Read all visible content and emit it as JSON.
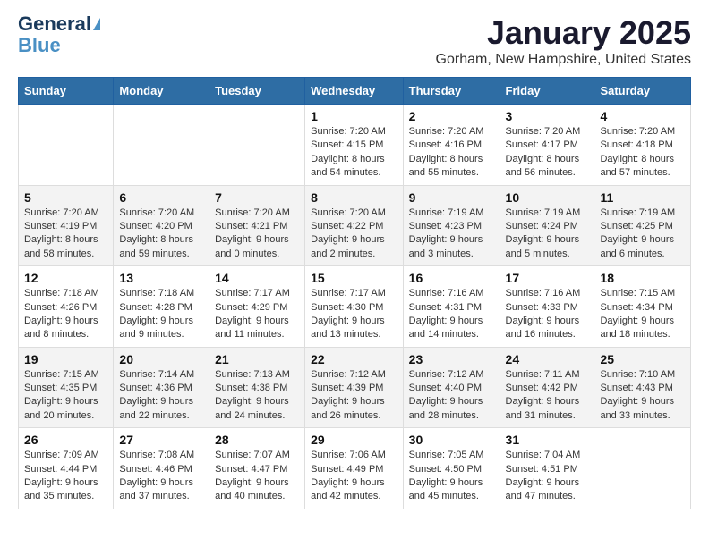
{
  "header": {
    "logo_general": "General",
    "logo_blue": "Blue",
    "month_title": "January 2025",
    "location": "Gorham, New Hampshire, United States"
  },
  "weekdays": [
    "Sunday",
    "Monday",
    "Tuesday",
    "Wednesday",
    "Thursday",
    "Friday",
    "Saturday"
  ],
  "weeks": [
    [
      {
        "day": "",
        "sunrise": "",
        "sunset": "",
        "daylight": ""
      },
      {
        "day": "",
        "sunrise": "",
        "sunset": "",
        "daylight": ""
      },
      {
        "day": "",
        "sunrise": "",
        "sunset": "",
        "daylight": ""
      },
      {
        "day": "1",
        "sunrise": "Sunrise: 7:20 AM",
        "sunset": "Sunset: 4:15 PM",
        "daylight": "Daylight: 8 hours and 54 minutes."
      },
      {
        "day": "2",
        "sunrise": "Sunrise: 7:20 AM",
        "sunset": "Sunset: 4:16 PM",
        "daylight": "Daylight: 8 hours and 55 minutes."
      },
      {
        "day": "3",
        "sunrise": "Sunrise: 7:20 AM",
        "sunset": "Sunset: 4:17 PM",
        "daylight": "Daylight: 8 hours and 56 minutes."
      },
      {
        "day": "4",
        "sunrise": "Sunrise: 7:20 AM",
        "sunset": "Sunset: 4:18 PM",
        "daylight": "Daylight: 8 hours and 57 minutes."
      }
    ],
    [
      {
        "day": "5",
        "sunrise": "Sunrise: 7:20 AM",
        "sunset": "Sunset: 4:19 PM",
        "daylight": "Daylight: 8 hours and 58 minutes."
      },
      {
        "day": "6",
        "sunrise": "Sunrise: 7:20 AM",
        "sunset": "Sunset: 4:20 PM",
        "daylight": "Daylight: 8 hours and 59 minutes."
      },
      {
        "day": "7",
        "sunrise": "Sunrise: 7:20 AM",
        "sunset": "Sunset: 4:21 PM",
        "daylight": "Daylight: 9 hours and 0 minutes."
      },
      {
        "day": "8",
        "sunrise": "Sunrise: 7:20 AM",
        "sunset": "Sunset: 4:22 PM",
        "daylight": "Daylight: 9 hours and 2 minutes."
      },
      {
        "day": "9",
        "sunrise": "Sunrise: 7:19 AM",
        "sunset": "Sunset: 4:23 PM",
        "daylight": "Daylight: 9 hours and 3 minutes."
      },
      {
        "day": "10",
        "sunrise": "Sunrise: 7:19 AM",
        "sunset": "Sunset: 4:24 PM",
        "daylight": "Daylight: 9 hours and 5 minutes."
      },
      {
        "day": "11",
        "sunrise": "Sunrise: 7:19 AM",
        "sunset": "Sunset: 4:25 PM",
        "daylight": "Daylight: 9 hours and 6 minutes."
      }
    ],
    [
      {
        "day": "12",
        "sunrise": "Sunrise: 7:18 AM",
        "sunset": "Sunset: 4:26 PM",
        "daylight": "Daylight: 9 hours and 8 minutes."
      },
      {
        "day": "13",
        "sunrise": "Sunrise: 7:18 AM",
        "sunset": "Sunset: 4:28 PM",
        "daylight": "Daylight: 9 hours and 9 minutes."
      },
      {
        "day": "14",
        "sunrise": "Sunrise: 7:17 AM",
        "sunset": "Sunset: 4:29 PM",
        "daylight": "Daylight: 9 hours and 11 minutes."
      },
      {
        "day": "15",
        "sunrise": "Sunrise: 7:17 AM",
        "sunset": "Sunset: 4:30 PM",
        "daylight": "Daylight: 9 hours and 13 minutes."
      },
      {
        "day": "16",
        "sunrise": "Sunrise: 7:16 AM",
        "sunset": "Sunset: 4:31 PM",
        "daylight": "Daylight: 9 hours and 14 minutes."
      },
      {
        "day": "17",
        "sunrise": "Sunrise: 7:16 AM",
        "sunset": "Sunset: 4:33 PM",
        "daylight": "Daylight: 9 hours and 16 minutes."
      },
      {
        "day": "18",
        "sunrise": "Sunrise: 7:15 AM",
        "sunset": "Sunset: 4:34 PM",
        "daylight": "Daylight: 9 hours and 18 minutes."
      }
    ],
    [
      {
        "day": "19",
        "sunrise": "Sunrise: 7:15 AM",
        "sunset": "Sunset: 4:35 PM",
        "daylight": "Daylight: 9 hours and 20 minutes."
      },
      {
        "day": "20",
        "sunrise": "Sunrise: 7:14 AM",
        "sunset": "Sunset: 4:36 PM",
        "daylight": "Daylight: 9 hours and 22 minutes."
      },
      {
        "day": "21",
        "sunrise": "Sunrise: 7:13 AM",
        "sunset": "Sunset: 4:38 PM",
        "daylight": "Daylight: 9 hours and 24 minutes."
      },
      {
        "day": "22",
        "sunrise": "Sunrise: 7:12 AM",
        "sunset": "Sunset: 4:39 PM",
        "daylight": "Daylight: 9 hours and 26 minutes."
      },
      {
        "day": "23",
        "sunrise": "Sunrise: 7:12 AM",
        "sunset": "Sunset: 4:40 PM",
        "daylight": "Daylight: 9 hours and 28 minutes."
      },
      {
        "day": "24",
        "sunrise": "Sunrise: 7:11 AM",
        "sunset": "Sunset: 4:42 PM",
        "daylight": "Daylight: 9 hours and 31 minutes."
      },
      {
        "day": "25",
        "sunrise": "Sunrise: 7:10 AM",
        "sunset": "Sunset: 4:43 PM",
        "daylight": "Daylight: 9 hours and 33 minutes."
      }
    ],
    [
      {
        "day": "26",
        "sunrise": "Sunrise: 7:09 AM",
        "sunset": "Sunset: 4:44 PM",
        "daylight": "Daylight: 9 hours and 35 minutes."
      },
      {
        "day": "27",
        "sunrise": "Sunrise: 7:08 AM",
        "sunset": "Sunset: 4:46 PM",
        "daylight": "Daylight: 9 hours and 37 minutes."
      },
      {
        "day": "28",
        "sunrise": "Sunrise: 7:07 AM",
        "sunset": "Sunset: 4:47 PM",
        "daylight": "Daylight: 9 hours and 40 minutes."
      },
      {
        "day": "29",
        "sunrise": "Sunrise: 7:06 AM",
        "sunset": "Sunset: 4:49 PM",
        "daylight": "Daylight: 9 hours and 42 minutes."
      },
      {
        "day": "30",
        "sunrise": "Sunrise: 7:05 AM",
        "sunset": "Sunset: 4:50 PM",
        "daylight": "Daylight: 9 hours and 45 minutes."
      },
      {
        "day": "31",
        "sunrise": "Sunrise: 7:04 AM",
        "sunset": "Sunset: 4:51 PM",
        "daylight": "Daylight: 9 hours and 47 minutes."
      },
      {
        "day": "",
        "sunrise": "",
        "sunset": "",
        "daylight": ""
      }
    ]
  ]
}
